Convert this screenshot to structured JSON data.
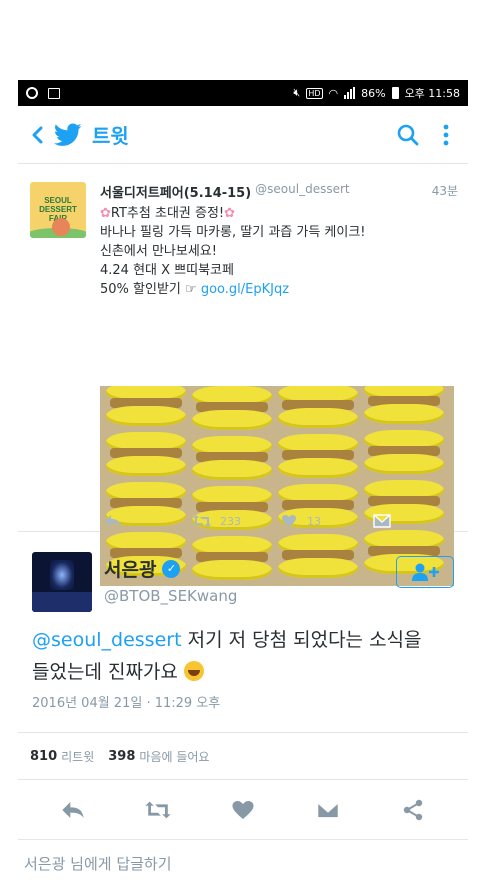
{
  "status_bar": {
    "battery": "86%",
    "time": "오후 11:58",
    "hd": "HD"
  },
  "app_bar": {
    "title": "트윗",
    "icons": [
      "back-arrow-icon",
      "twitter-bird-icon",
      "search-icon",
      "more-vertical-icon"
    ],
    "accent_color": "#1da1f2"
  },
  "quoted_tweet": {
    "name": "서울디저트페어(5.14-15)",
    "handle": "@seoul_dessert",
    "time": "43분",
    "avatar_text": "SEOUL DESSERT FAIR",
    "lines": [
      "RT추첨 초대권 증정!",
      "바나나 필링 가득 마카롱, 딸기 과즙 가득 케이크!",
      "신촌에서 만나보세요!",
      "4.24 현대 X 쁘띠북코페",
      "50% 할인받기"
    ],
    "link": "goo.gl/EpKJqz",
    "retweets": "233",
    "likes": "13"
  },
  "main_tweet": {
    "name": "서은광",
    "handle": "@BTOB_SEKwang",
    "mention": "@seoul_dessert",
    "text_line1": " 저기 저 당첨 되었다는 소식을",
    "text_line2": "들었는데 진짜가요 ",
    "date": "2016년 04월 21일 · 11:29 오후",
    "retweet_count": "810",
    "retweet_label": "리트윗",
    "like_count": "398",
    "like_label": "마음에 들어요"
  },
  "reply_box": {
    "placeholder": "서은광 님에게 답글하기"
  }
}
